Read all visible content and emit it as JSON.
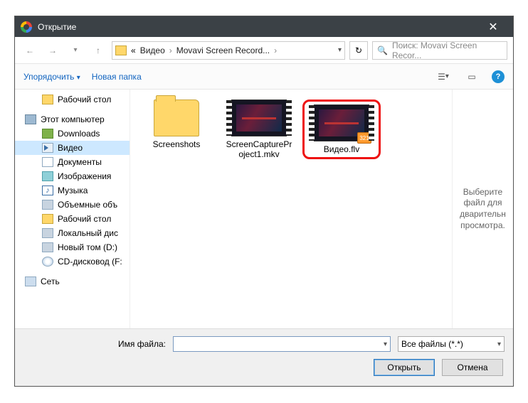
{
  "titlebar": {
    "title": "Открытие",
    "close": "✕"
  },
  "nav": {
    "back": "←",
    "fwd": "→",
    "up": "↑",
    "chev": "«",
    "crumbs": [
      "Видео",
      "Movavi Screen Record..."
    ],
    "sep": "›",
    "refresh": "↻",
    "search_icon": "🔍",
    "search_placeholder": "Поиск: Movavi Screen Recor..."
  },
  "toolbar": {
    "organize": "Упорядочить",
    "newfolder": "Новая папка",
    "help": "?"
  },
  "tree": {
    "desktop": "Рабочий стол",
    "thispc": "Этот компьютер",
    "downloads": "Downloads",
    "video": "Видео",
    "documents": "Документы",
    "pictures": "Изображения",
    "music": "Музыка",
    "vol3d": "Объемные объ",
    "desktop2": "Рабочий стол",
    "localdisk": "Локальный дис",
    "newvol": "Новый том (D:)",
    "cddrive": "CD-дисковод (F:",
    "network": "Сеть"
  },
  "files": {
    "screenshots": "Screenshots",
    "capture": "ScreenCapturePr\noject1.mkv",
    "videoflv": "Видео.flv",
    "badge": "321"
  },
  "preview": {
    "text": "Выберите файл для дварительн просмотра."
  },
  "footer": {
    "filename_label": "Имя файла:",
    "filename_value": "",
    "filter": "Все файлы (*.*)",
    "open": "Открыть",
    "cancel": "Отмена"
  }
}
